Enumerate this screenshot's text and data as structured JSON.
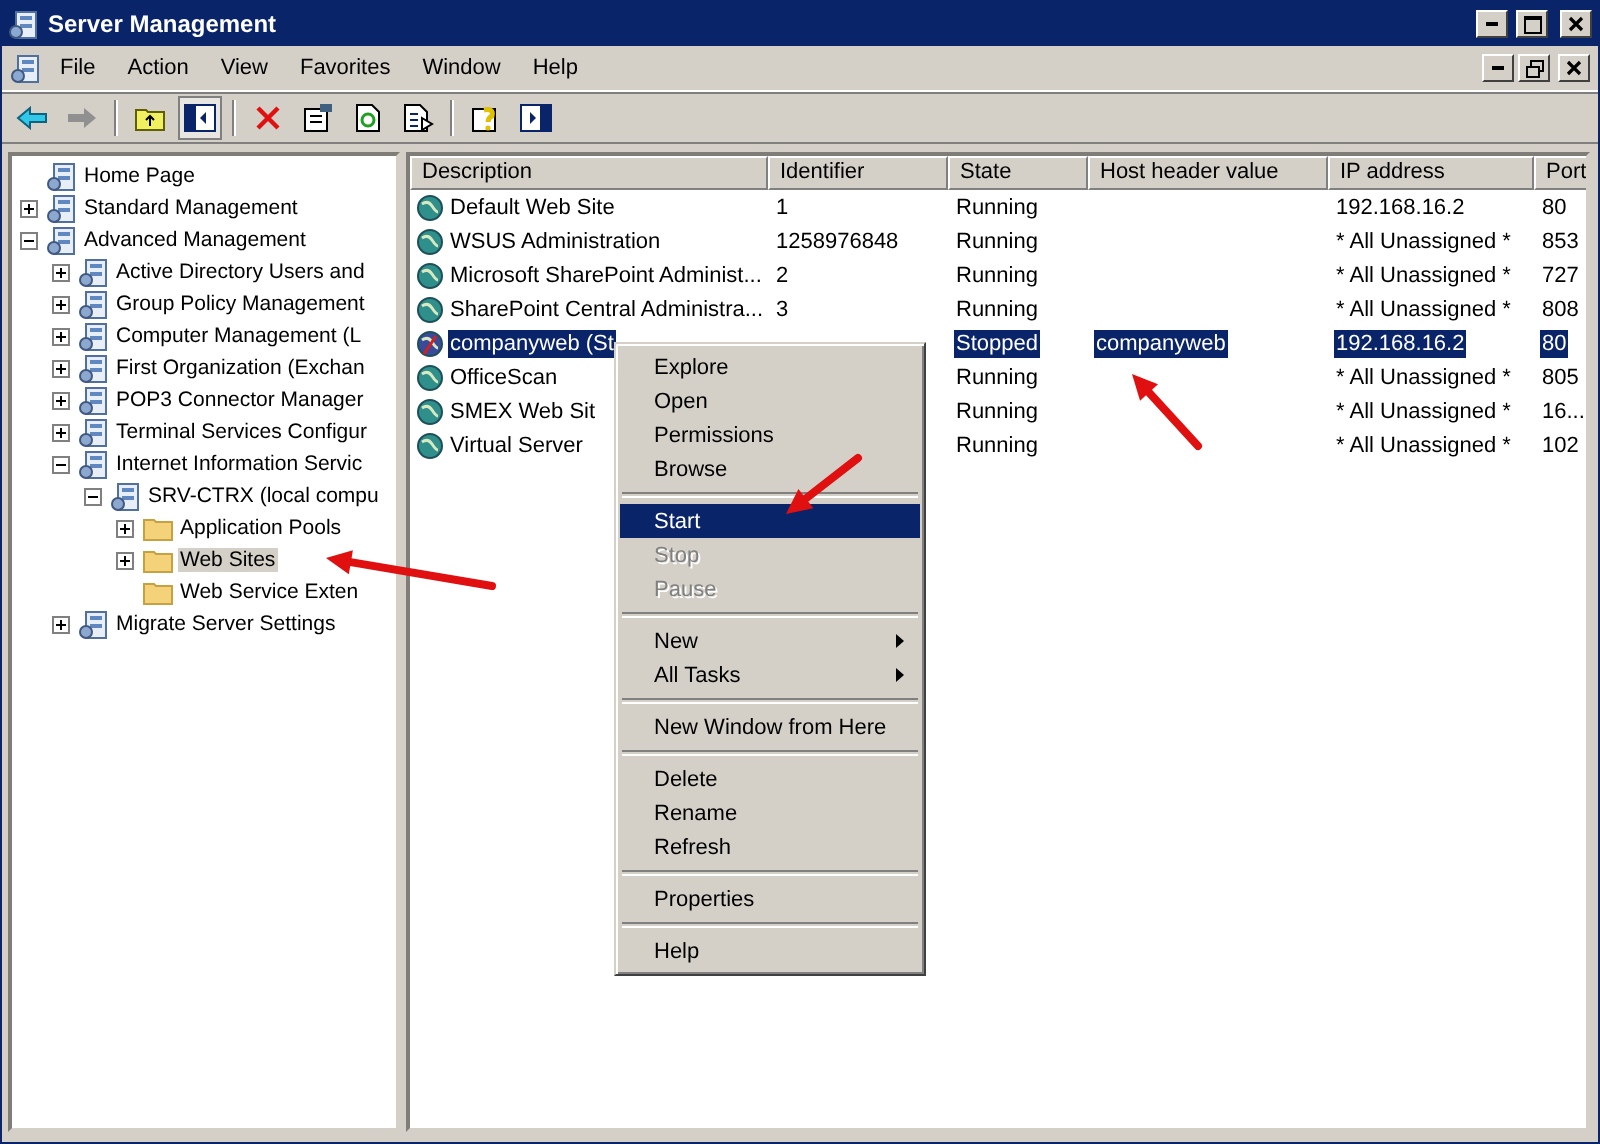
{
  "window": {
    "title": "Server Management"
  },
  "menu_bar": [
    "File",
    "Action",
    "View",
    "Favorites",
    "Window",
    "Help"
  ],
  "tree": [
    {
      "label": "Home Page",
      "kind": "leaf",
      "selected": false
    },
    {
      "label": "Standard Management",
      "kind": "branch",
      "expanded": false,
      "selected": false
    },
    {
      "label": "Advanced Management",
      "kind": "branch",
      "expanded": true,
      "selected": false,
      "children": [
        {
          "label": "Active Directory Users and",
          "kind": "branch",
          "expanded": false,
          "selected": false
        },
        {
          "label": "Group Policy Management",
          "kind": "branch",
          "expanded": false,
          "selected": false
        },
        {
          "label": "Computer Management (L",
          "kind": "branch",
          "expanded": false,
          "selected": false
        },
        {
          "label": "First Organization (Exchan",
          "kind": "branch",
          "expanded": false,
          "selected": false
        },
        {
          "label": "POP3 Connector Manager",
          "kind": "branch",
          "expanded": false,
          "selected": false
        },
        {
          "label": "Terminal Services Configur",
          "kind": "branch",
          "expanded": false,
          "selected": false
        },
        {
          "label": "Internet Information Servic",
          "kind": "branch",
          "expanded": true,
          "selected": false,
          "children": [
            {
              "label": "SRV-CTRX (local compu",
              "kind": "branch",
              "expanded": true,
              "selected": false,
              "children": [
                {
                  "label": "Application Pools",
                  "kind": "branch",
                  "expanded": false,
                  "selected": false
                },
                {
                  "label": "Web Sites",
                  "kind": "branch",
                  "expanded": false,
                  "selected": true
                },
                {
                  "label": "Web Service Exten",
                  "kind": "leaf",
                  "selected": false
                }
              ]
            }
          ]
        },
        {
          "label": "Migrate Server Settings",
          "kind": "branch",
          "expanded": false,
          "selected": false
        }
      ]
    }
  ],
  "table": {
    "columns": [
      "Description",
      "Identifier",
      "State",
      "Host header value",
      "IP address",
      "Port"
    ],
    "rows": [
      {
        "kind": "running",
        "selected": false,
        "description": "Default Web Site",
        "identifier": "1",
        "state": "Running",
        "ip": "192.168.16.2",
        "port": "80"
      },
      {
        "kind": "running",
        "selected": false,
        "description": "WSUS Administration",
        "identifier": "1258976848",
        "state": "Running",
        "ip": "* All Unassigned *",
        "port": "853"
      },
      {
        "kind": "running",
        "selected": false,
        "description": "Microsoft SharePoint Administ...",
        "identifier": "2",
        "state": "Running",
        "ip": "* All Unassigned *",
        "port": "727"
      },
      {
        "kind": "running",
        "selected": false,
        "description": "SharePoint Central Administra...",
        "identifier": "3",
        "state": "Running",
        "ip": "* All Unassigned *",
        "port": "808"
      },
      {
        "kind": "stopped",
        "selected": true,
        "description": "companyweb (St",
        "state": "Stopped",
        "host": "companyweb",
        "ip": "192.168.16.2",
        "port": "80"
      },
      {
        "kind": "running",
        "selected": false,
        "description": "OfficeScan",
        "state": "Running",
        "ip": "* All Unassigned *",
        "port": "805"
      },
      {
        "kind": "running",
        "selected": false,
        "description": "SMEX Web Sit",
        "state": "Running",
        "ip": "* All Unassigned *",
        "port": "16..."
      },
      {
        "kind": "running",
        "selected": false,
        "description": "Virtual Server",
        "state": "Running",
        "ip": "* All Unassigned *",
        "port": "102"
      }
    ]
  },
  "context_menu": [
    {
      "kind": "item",
      "label": "Explore",
      "disabled": false,
      "selected": false,
      "submenu": false
    },
    {
      "kind": "item",
      "label": "Open",
      "disabled": false,
      "selected": false,
      "submenu": false
    },
    {
      "kind": "item",
      "label": "Permissions",
      "disabled": false,
      "selected": false,
      "submenu": false
    },
    {
      "kind": "item",
      "label": "Browse",
      "disabled": false,
      "selected": false,
      "submenu": false
    },
    {
      "kind": "separator"
    },
    {
      "kind": "item",
      "label": "Start",
      "disabled": false,
      "selected": true,
      "submenu": false
    },
    {
      "kind": "item",
      "label": "Stop",
      "disabled": true,
      "selected": false,
      "submenu": false
    },
    {
      "kind": "item",
      "label": "Pause",
      "disabled": true,
      "selected": false,
      "submenu": false
    },
    {
      "kind": "separator"
    },
    {
      "kind": "item",
      "label": "New",
      "disabled": false,
      "selected": false,
      "submenu": true
    },
    {
      "kind": "item",
      "label": "All Tasks",
      "disabled": false,
      "selected": false,
      "submenu": true
    },
    {
      "kind": "separator"
    },
    {
      "kind": "item",
      "label": "New Window from Here",
      "disabled": false,
      "selected": false,
      "submenu": false
    },
    {
      "kind": "separator"
    },
    {
      "kind": "item",
      "label": "Delete",
      "disabled": false,
      "selected": false,
      "submenu": false
    },
    {
      "kind": "item",
      "label": "Rename",
      "disabled": false,
      "selected": false,
      "submenu": false
    },
    {
      "kind": "item",
      "label": "Refresh",
      "disabled": false,
      "selected": false,
      "submenu": false
    },
    {
      "kind": "separator"
    },
    {
      "kind": "item",
      "label": "Properties",
      "disabled": false,
      "selected": false,
      "submenu": false
    },
    {
      "kind": "separator"
    },
    {
      "kind": "item",
      "label": "Help",
      "disabled": false,
      "selected": false,
      "submenu": false
    }
  ]
}
